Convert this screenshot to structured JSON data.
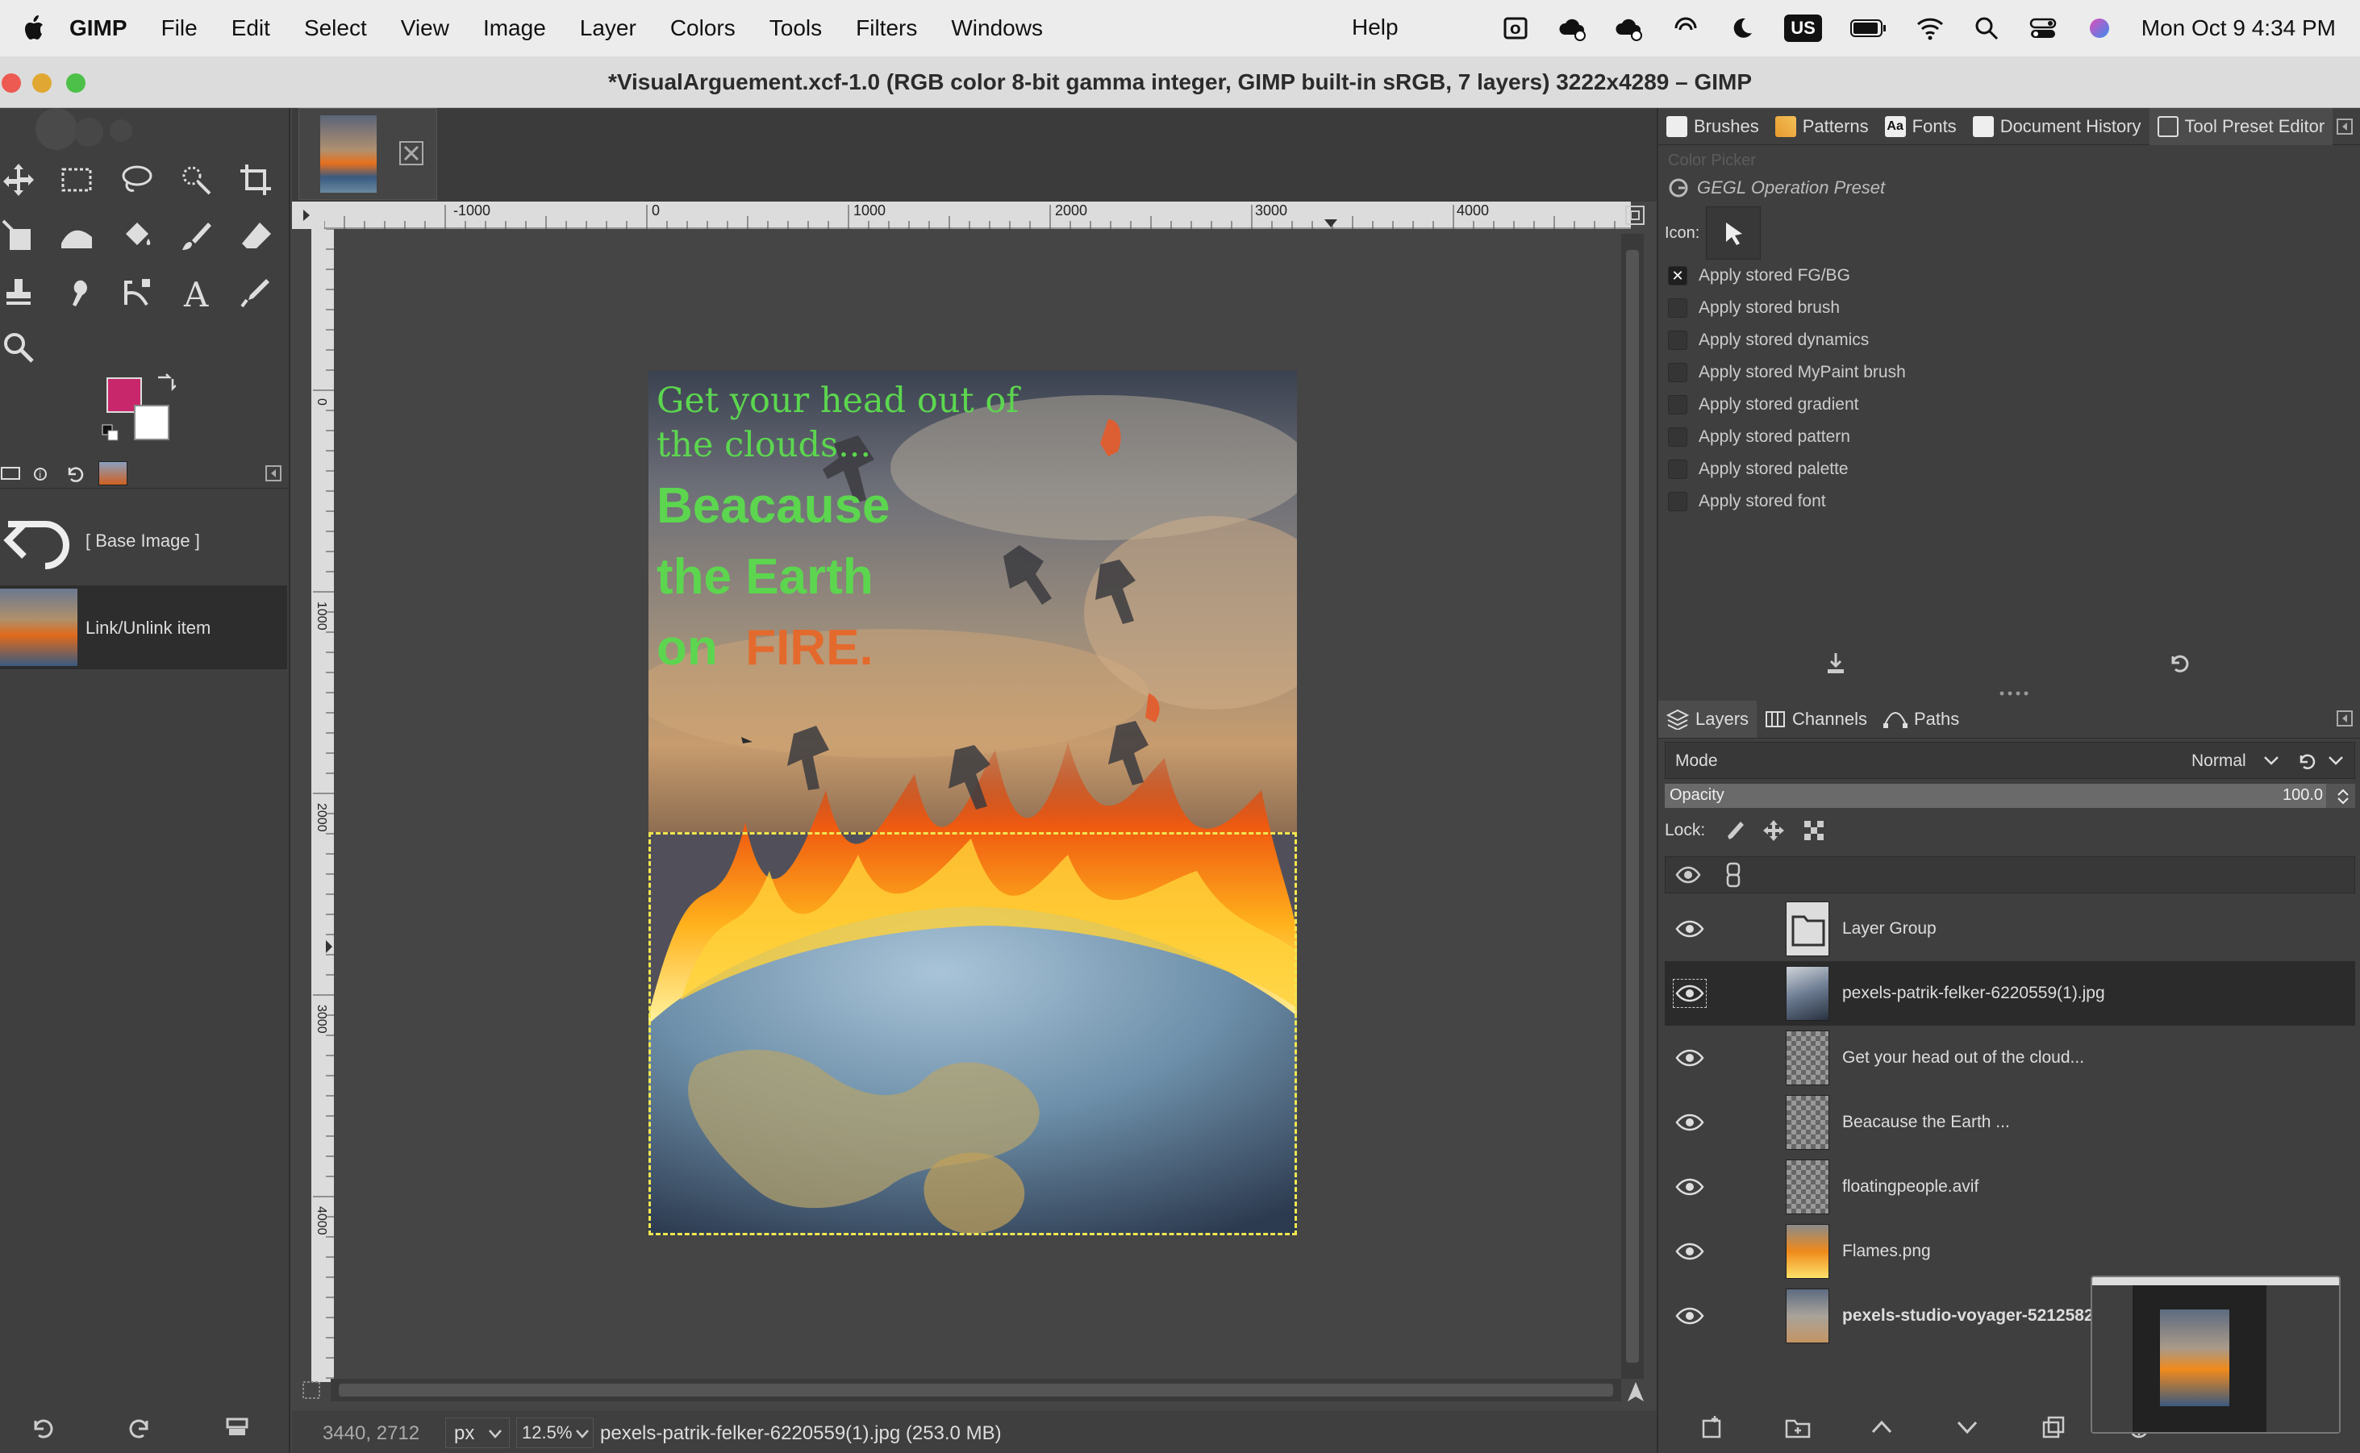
{
  "menubar": {
    "items": [
      {
        "label": "GIMP",
        "bold": true
      },
      {
        "label": "File"
      },
      {
        "label": "Edit"
      },
      {
        "label": "Select"
      },
      {
        "label": "View"
      },
      {
        "label": "Image"
      },
      {
        "label": "Layer"
      },
      {
        "label": "Colors"
      },
      {
        "label": "Tools"
      },
      {
        "label": "Filters"
      },
      {
        "label": "Windows"
      }
    ],
    "help": "Help",
    "input_source": "US",
    "clock": "Mon Oct 9  4:34 PM"
  },
  "window": {
    "title": "*VisualArguement.xcf-1.0 (RGB color 8-bit gamma integer, GIMP built-in sRGB, 7 layers) 3222x4289 – GIMP"
  },
  "colors": {
    "foreground": "#c8276b",
    "background": "#ffffff",
    "title_green": "#5cd64f",
    "fire_orange": "#e36a2c",
    "selection_dash": "#f2e650"
  },
  "undo_history": {
    "items": [
      {
        "label": "[ Base Image ]"
      },
      {
        "label": "Link/Unlink item"
      }
    ]
  },
  "ruler": {
    "h_labels": [
      "-1000",
      "0",
      "1000",
      "2000",
      "3000",
      "4000"
    ],
    "v_labels": [
      "0",
      "1000",
      "2000",
      "3000",
      "4000"
    ]
  },
  "poster": {
    "line1": "Get your head out of",
    "line2": "the clouds...",
    "line3": "Beacause",
    "line4": "the Earth",
    "line5_a": "on",
    "line5_b": "FIRE."
  },
  "statusbar": {
    "coords": "3440, 2712",
    "unit": "px",
    "zoom": "12.5%",
    "message": "pexels-patrik-felker-6220559(1).jpg (253.0 MB)"
  },
  "preset_tabs": [
    {
      "label": "Brushes"
    },
    {
      "label": "Patterns"
    },
    {
      "label": "Fonts"
    },
    {
      "label": "Document History"
    },
    {
      "label": "Tool Preset Editor"
    }
  ],
  "preset_editor": {
    "faded_label": "Color Picker",
    "operation": "GEGL Operation Preset",
    "icon_label": "Icon:",
    "options": [
      {
        "label": "Apply stored FG/BG",
        "checked": true
      },
      {
        "label": "Apply stored brush",
        "checked": false
      },
      {
        "label": "Apply stored dynamics",
        "checked": false
      },
      {
        "label": "Apply stored MyPaint brush",
        "checked": false
      },
      {
        "label": "Apply stored gradient",
        "checked": false
      },
      {
        "label": "Apply stored pattern",
        "checked": false
      },
      {
        "label": "Apply stored palette",
        "checked": false
      },
      {
        "label": "Apply stored font",
        "checked": false
      }
    ]
  },
  "layers_panel": {
    "tabs": [
      {
        "label": "Layers"
      },
      {
        "label": "Channels"
      },
      {
        "label": "Paths"
      }
    ],
    "mode_label": "Mode",
    "mode_value": "Normal",
    "opacity_label": "Opacity",
    "opacity_value": "100.0",
    "lock_label": "Lock:",
    "layers": [
      {
        "name": "Layer Group",
        "thumb": "folder"
      },
      {
        "name": "pexels-patrik-felker-6220559(1).jpg",
        "thumb": "photo",
        "selected": true
      },
      {
        "name": "Get your head out of the cloud...",
        "thumb": "checker"
      },
      {
        "name": "Beacause the Earth  ...",
        "thumb": "checker"
      },
      {
        "name": "floatingpeople.avif",
        "thumb": "checker"
      },
      {
        "name": "Flames.png",
        "thumb": "flames"
      },
      {
        "name": "pexels-studio-voyager-5212582.",
        "thumb": "sky",
        "bold": true
      }
    ]
  }
}
